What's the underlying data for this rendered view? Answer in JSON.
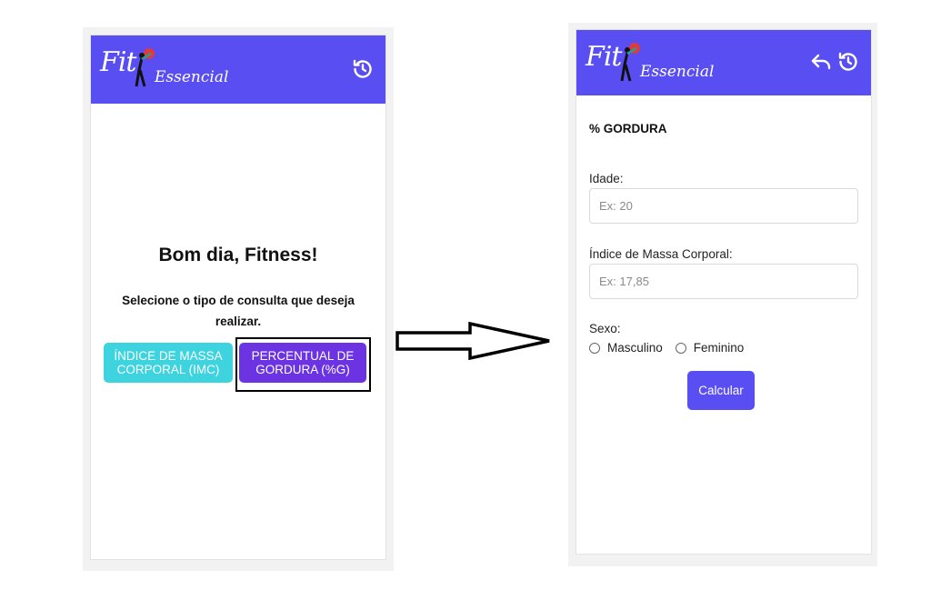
{
  "brand": {
    "logo_fit": "Fit",
    "logo_essencial": "Essencial"
  },
  "colors": {
    "header": "#594ef2",
    "imc_button": "#3dd3df",
    "pg_button": "#6b33e2",
    "calc_button": "#594ef2"
  },
  "home": {
    "greeting": "Bom dia, Fitness!",
    "prompt": "Selecione o tipo de consulta que deseja realizar.",
    "imc_button": "ÍNDICE DE MASSA CORPORAL (IMC)",
    "pg_button": "PERCENTUAL DE GORDURA (%G)",
    "icons": [
      "history-icon"
    ]
  },
  "form": {
    "title": "% GORDURA",
    "age_label": "Idade:",
    "age_placeholder": "Ex: 20",
    "bmi_label": "Índice de Massa Corporal:",
    "bmi_placeholder": "Ex: 17,85",
    "sex_label": "Sexo:",
    "sex_options": [
      "Masculino",
      "Feminino"
    ],
    "submit": "Calcular",
    "icons": [
      "back-icon",
      "history-icon"
    ]
  }
}
